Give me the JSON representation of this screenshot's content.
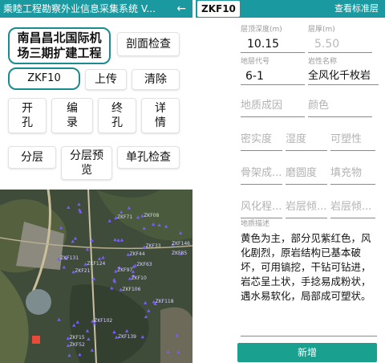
{
  "left": {
    "title": "乘睦工程勘察外业信息采集系统 V...",
    "back_icon": "arrow-left-icon",
    "project_button": "南昌昌北国际机场三期扩建工程",
    "section_check_button": "剖面检查",
    "borehole_button": "ZKF10",
    "upload_button": "上传",
    "clear_button": "清除",
    "open_hole_button": "开孔",
    "edit_log_button": "编录",
    "end_hole_button": "终孔",
    "details_button": "详情",
    "layering_button": "分层",
    "layer_preview_button": "分层预览",
    "single_hole_check_button": "单孔检查"
  },
  "map_labels": [
    "ZKF106",
    "ZKF15",
    "ZKF08",
    "ZKF10",
    "ZKF21",
    "ZKF33",
    "ZKF44",
    "ZKF52",
    "ZKF63",
    "ZKF71",
    "ZKF85",
    "ZKF97",
    "ZKF102",
    "ZKF118",
    "ZKF124",
    "ZKF131",
    "ZKF139",
    "ZKF146"
  ],
  "right": {
    "badge": "ZKF10",
    "view_standard_layer": "查看标准层",
    "top_depth_label": "层顶深度(m)",
    "top_depth_value": "10.15",
    "bottom_depth_label": "层厚(m)",
    "bottom_depth_value": "5.50",
    "strata_code_label": "地层代号",
    "strata_code_value": "6-1",
    "rock_name_label": "岩性名称",
    "rock_name_value": "全风化千枚岩",
    "geo_origin_placeholder": "地质成因",
    "color_placeholder": "颜色",
    "density_placeholder": "密实度",
    "humidity_placeholder": "湿度",
    "plasticity_placeholder": "可塑性",
    "skeleton_placeholder": "骨架成...",
    "roundness_placeholder": "磨圆度",
    "filling_placeholder": "填充物",
    "weathering_placeholder": "风化程...",
    "dip_dir_placeholder": "岩层倾...",
    "dip_angle_placeholder": "岩层倾...",
    "description_label": "地质描述",
    "description_text": "黄色为主，部分见紫红色，风化剧烈，原岩结构已基本破坏，可用镐挖，干钻可钻进，岩芯呈土状，手捻易成粉状，遇水易软化，局部成可塑状。",
    "submit_button": "新增"
  },
  "colors": {
    "accent": "#1a9aa0",
    "submit": "#1aa08f",
    "map_point": "#7b5cff"
  }
}
